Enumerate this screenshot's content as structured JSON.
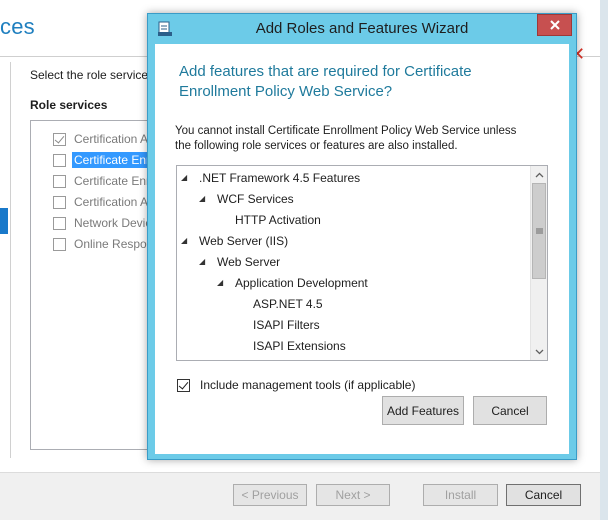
{
  "background": {
    "title": "ces",
    "select_label": "Select the role services",
    "role_services_header": "Role services",
    "role_items": [
      {
        "label": "Certification A",
        "checked": true
      },
      {
        "label": "Certificate Enr",
        "checked": false,
        "selected": true
      },
      {
        "label": "Certificate Enr",
        "checked": false
      },
      {
        "label": "Certification A",
        "checked": false
      },
      {
        "label": "Network Devic",
        "checked": false
      },
      {
        "label": "Online Respor",
        "checked": false
      }
    ],
    "red_mark": "✕",
    "buttons": {
      "previous": "< Previous",
      "next": "Next >",
      "install": "Install",
      "cancel": "Cancel"
    }
  },
  "dialog": {
    "title": "Add Roles and Features Wizard",
    "header_line1": "Add features that are required for Certificate",
    "header_line2": "Enrollment Policy Web Service?",
    "message_line1": "You cannot install Certificate Enrollment Policy Web Service unless",
    "message_line2": "the following role services or features are also installed.",
    "tree_items": [
      {
        "label": ".NET Framework 4.5 Features",
        "expanded": true
      },
      {
        "label": "WCF Services",
        "expanded": true
      },
      {
        "label": "HTTP Activation",
        "expanded": false
      },
      {
        "label": "Web Server (IIS)",
        "expanded": true
      },
      {
        "label": "Web Server",
        "expanded": true
      },
      {
        "label": "Application Development",
        "expanded": true
      },
      {
        "label": "ASP.NET 4.5",
        "expanded": false
      },
      {
        "label": "ISAPI Filters",
        "expanded": false
      },
      {
        "label": "ISAPI Extensions",
        "expanded": false
      }
    ],
    "include_mgmt_label": "Include management tools (if applicable)",
    "include_mgmt_checked": true,
    "add_features_label": "Add Features",
    "cancel_label": "Cancel"
  },
  "colors": {
    "dialog_frame": "#6ccbe8",
    "close_button": "#c75050",
    "header_text": "#1f7a9c",
    "accent": "#1979ca"
  }
}
